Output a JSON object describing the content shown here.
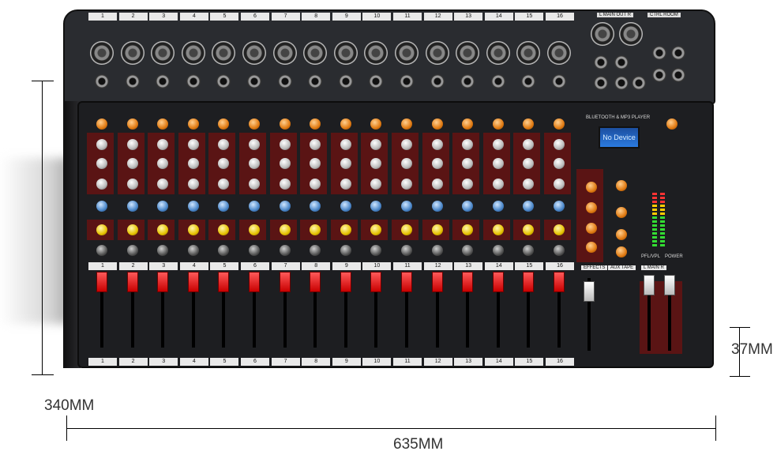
{
  "rear_panel": {
    "channel_numbers": [
      "1",
      "2",
      "3",
      "4",
      "5",
      "6",
      "7",
      "8",
      "9",
      "10",
      "11",
      "12",
      "13",
      "14",
      "15",
      "16"
    ],
    "main_out_label": "L MAIN OUT R",
    "ctrl_room_label": "CTRL ROOM"
  },
  "top_panel": {
    "player_label": "BLUETOOTH & MP3 PLAYER",
    "lcd_text": "No Device",
    "effects_label": "EFFECTS",
    "aux_tape_label": "AUX TAPE",
    "main_label": "L MAIN R",
    "pfl_label": "PFL/VPL",
    "power_label": "POWER"
  },
  "dimensions": {
    "height": "340MM",
    "width": "635MM",
    "depth": "37MM"
  },
  "colors": {
    "panel": "#1d1e21",
    "strip_red": "#5a1414",
    "fader_red": "#d40000",
    "knob_orange": "#e07a12",
    "knob_blue": "#4a86c8",
    "knob_yellow": "#e6c200",
    "lcd_blue": "#2b7be0"
  }
}
